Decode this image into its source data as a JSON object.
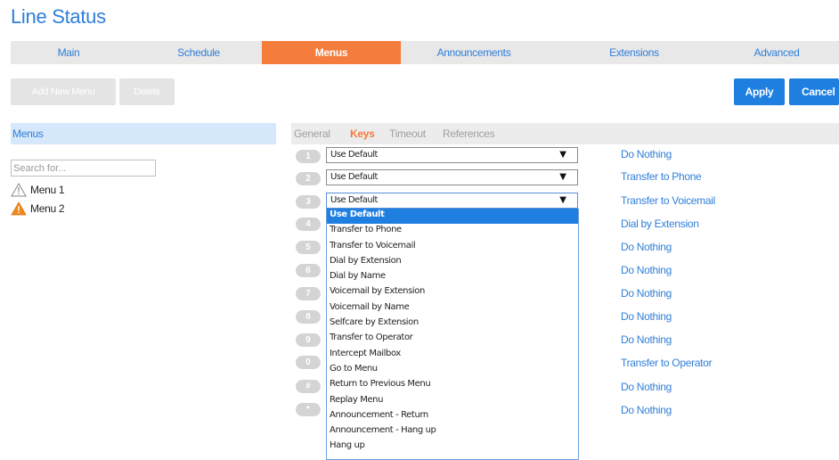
{
  "page_title": "Line Status",
  "tabs": [
    "Main",
    "Schedule",
    "Menus",
    "Announcements",
    "Extensions",
    "Advanced"
  ],
  "active_tab": "Menus",
  "toolbar": {
    "add_new_menu": "Add New Menu",
    "delete": "Delete",
    "apply": "Apply",
    "cancel": "Cancel"
  },
  "sidebar": {
    "header": "Menus",
    "search_placeholder": "Search for...",
    "items": [
      {
        "label": "Menu 1",
        "icon": "warning-outline-icon"
      },
      {
        "label": "Menu 2",
        "icon": "warning-filled-icon"
      }
    ]
  },
  "subtabs": [
    "General",
    "Keys",
    "Timeout",
    "References"
  ],
  "active_subtab": "Keys",
  "keys": [
    {
      "key": "1",
      "select_value": "Use Default",
      "action": "Do Nothing"
    },
    {
      "key": "2",
      "select_value": "Use Default",
      "action": "Transfer to Phone"
    },
    {
      "key": "3",
      "select_value": "Use Default",
      "action": "Transfer to Voicemail"
    },
    {
      "key": "4",
      "action": "Dial by Extension"
    },
    {
      "key": "5",
      "action": "Do Nothing"
    },
    {
      "key": "6",
      "action": "Do Nothing"
    },
    {
      "key": "7",
      "action": "Do Nothing"
    },
    {
      "key": "8",
      "action": "Do Nothing"
    },
    {
      "key": "9",
      "action": "Do Nothing"
    },
    {
      "key": "0",
      "action": "Transfer to Operator"
    },
    {
      "key": "#",
      "action": "Do Nothing"
    },
    {
      "key": "*",
      "action": "Do Nothing"
    }
  ],
  "dropdown_options": [
    "Use Default",
    "Transfer to Phone",
    "Transfer to Voicemail",
    "Dial by Extension",
    "Dial by Name",
    "Voicemail by Extension",
    "Voicemail by Name",
    "Selfcare by Extension",
    "Transfer to Operator",
    "Intercept Mailbox",
    "Go to Menu",
    "Return to Previous Menu",
    "Replay Menu",
    "Announcement - Return",
    "Announcement - Hang up",
    "Hang up"
  ],
  "dropdown_selected": "Use Default",
  "colors": {
    "accent": "#2f7fd8",
    "active_tab": "#f47c3c",
    "primary_button": "#1e7fe0",
    "warning": "#f08a1c"
  }
}
